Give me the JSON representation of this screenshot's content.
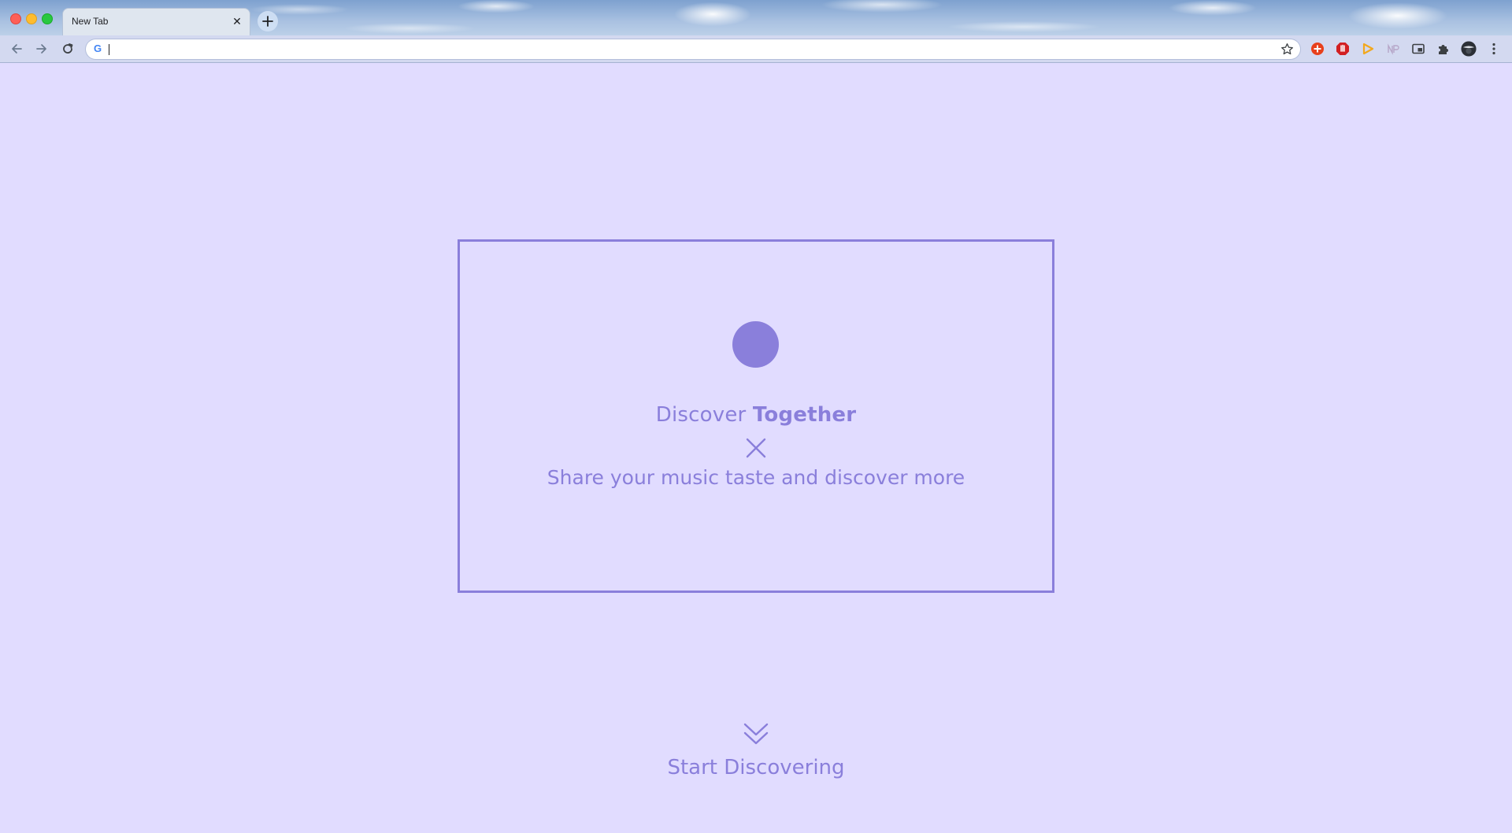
{
  "browser": {
    "tab": {
      "title": "New Tab"
    },
    "omnibox": {
      "value": ""
    }
  },
  "page": {
    "hero": {
      "title_light": "Discover",
      "title_bold": "Together",
      "subtitle": "Share your music taste and discover more"
    },
    "cta": {
      "label": "Start Discovering"
    }
  },
  "colors": {
    "page_background": "#e1dcff",
    "accent": "#8a7fdb"
  },
  "icons": {
    "hero_close": "close-icon",
    "scroll_down": "double-chevron-down-icon"
  }
}
